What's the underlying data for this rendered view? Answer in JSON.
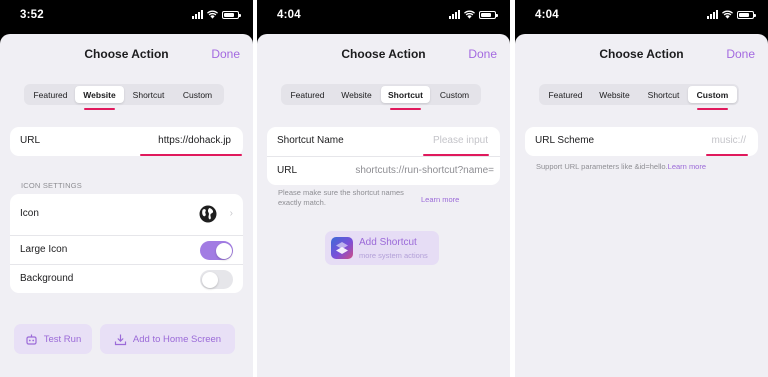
{
  "accent_color": "#a46ae0",
  "highlight_color": "#e0195c",
  "screens": [
    {
      "time": "3:52",
      "title": "Choose Action",
      "done": "Done",
      "tabs": [
        "Featured",
        "Website",
        "Shortcut",
        "Custom"
      ],
      "active_tab": "Website",
      "url_label": "URL",
      "url_value": "https://dohack.jp",
      "section_header": "ICON SETTINGS",
      "icon_label": "Icon",
      "icon_value": "globe-icon",
      "large_icon_label": "Large Icon",
      "large_icon_on": true,
      "background_label": "Background",
      "background_on": false,
      "test_run": "Test Run",
      "add_home": "Add to Home Screen"
    },
    {
      "time": "4:04",
      "title": "Choose Action",
      "done": "Done",
      "tabs": [
        "Featured",
        "Website",
        "Shortcut",
        "Custom"
      ],
      "active_tab": "Shortcut",
      "shortcut_name_label": "Shortcut Name",
      "shortcut_name_placeholder": "Please input",
      "url_label": "URL",
      "url_value": "shortcuts://run-shortcut?name=",
      "note": "Please make sure the shortcut names exactly match.",
      "learn_more": "Learn more",
      "add_shortcut": "Add Shortcut",
      "add_shortcut_sub": "more system actions"
    },
    {
      "time": "4:04",
      "title": "Choose Action",
      "done": "Done",
      "tabs": [
        "Featured",
        "Website",
        "Shortcut",
        "Custom"
      ],
      "active_tab": "Custom",
      "scheme_label": "URL Scheme",
      "scheme_placeholder": "music://",
      "note": "Support URL parameters like &id=hello.",
      "learn_more": "Learn more"
    }
  ]
}
